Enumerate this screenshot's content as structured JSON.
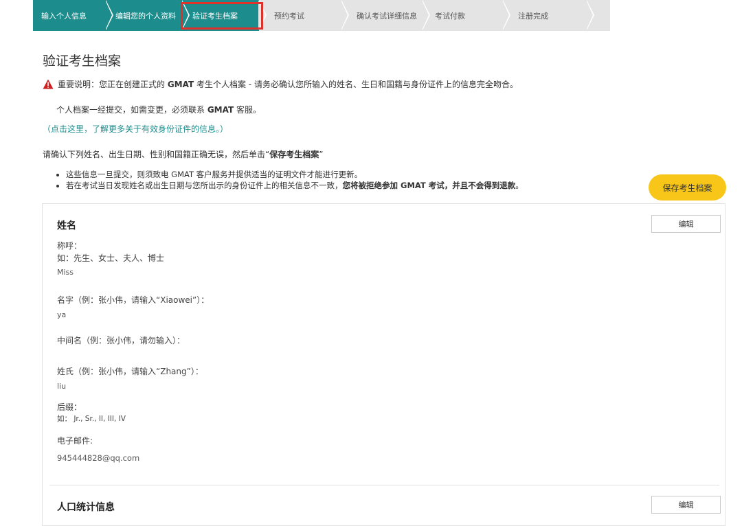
{
  "steps": [
    {
      "label": "输入个人信息"
    },
    {
      "label": "编辑您的个人资料"
    },
    {
      "label": "验证考生档案"
    },
    {
      "label": "预约考试"
    },
    {
      "label": "确认考试详细信息"
    },
    {
      "label": "考试付款"
    },
    {
      "label": "注册完成"
    }
  ],
  "page": {
    "title": "验证考生档案",
    "notice_prefix": "重要说明：您正在创建正式的 ",
    "notice_bold": "GMAT",
    "notice_suffix": " 考生个人档案 - 请务必确认您所输入的姓名、生日和国籍与身份证件上的信息完全吻合。",
    "line2_prefix": "个人档案一经提交，如需变更，必须联系 ",
    "line2_bold": "GMAT",
    "line2_suffix": " 客服。",
    "link": "（点击这里，了解更多关于有效身份证件的信息。）",
    "confirm_prefix": "请确认下列姓名、出生日期、性别和国籍正确无误，然后单击“",
    "confirm_bold": "保存考生档案",
    "confirm_suffix": "”",
    "bullet1": "这些信息一旦提交，则须致电 GMAT 客户服务并提供适当的证明文件才能进行更新。",
    "bullet2_prefix": "若在考试当日发现姓名或出生日期与您所出示的身份证件上的相关信息不一致，",
    "bullet2_bold": "您将被拒绝参加 GMAT 考试，并且不会得到退款",
    "bullet2_suffix": "。",
    "save_button": "保存考生档案"
  },
  "name_section": {
    "title": "姓名",
    "edit_button": "编辑",
    "salutation_label": "称呼：",
    "salutation_hint": "如：先生、女士、夫人、博士",
    "salutation_value": "Miss",
    "first_name_label": "名字（例：张小伟，请输入“Xiaowei”）：",
    "first_name_value": "ya",
    "middle_name_label": "中间名（例：张小伟，请勿输入）：",
    "last_name_label": "姓氏（例：张小伟，请输入“Zhang”）：",
    "last_name_value": "liu",
    "suffix_label": "后缀：",
    "suffix_hint": "如： Jr., Sr., II, III, IV",
    "email_label": "电子邮件:",
    "email_value": "945444828@qq.com"
  },
  "demographics_section": {
    "title": "人口统计信息",
    "edit_button": "编辑"
  },
  "colors": {
    "step_done": "#1c8c8c",
    "step_pending": "#e4e4e4",
    "highlight": "#e0302a",
    "save_button": "#f7c619",
    "link": "#1c8c8c",
    "warning": "#cc2222"
  }
}
